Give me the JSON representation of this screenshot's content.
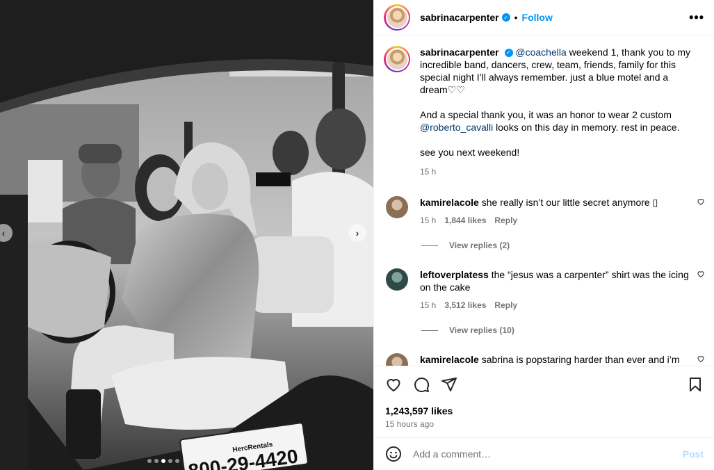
{
  "post": {
    "username": "sabrinacarpenter",
    "follow_label": "Follow",
    "separator": "•",
    "more_label": "•••",
    "plate_text": "800-29-4420",
    "plate_brand": "HercRentals",
    "caption": {
      "username": "sabrinacarpenter",
      "mention1": "@coachella",
      "text1": " weekend 1, thank you to my incredible band, dancers, crew, team, friends, family for this special night I’ll always remember. just a blue motel and a dream",
      "hearts": "♡♡",
      "text2a": "And a special thank you, it was an honor to wear 2 custom ",
      "mention2": "@roberto_cavalli",
      "text2b": " looks on this day in memory. rest in peace.",
      "text3": "see you next weekend!",
      "time": "15 h"
    },
    "comments": [
      {
        "username": "kamirelacole",
        "text": "she really isn’t our little secret anymore ▯",
        "time": "15 h",
        "likes": "1,844 likes",
        "reply": "Reply",
        "view_replies": "View replies (2)"
      },
      {
        "username": "leftoverplatess",
        "text": "the “jesus was a carpenter” shirt was the icing on the cake",
        "time": "15 h",
        "likes": "3,512 likes",
        "reply": "Reply",
        "view_replies": "View replies (10)"
      },
      {
        "username": "kamirelacole",
        "text": "sabrina is popstaring harder than ever and i’m here for it"
      }
    ],
    "likes_count": "1,243,597 likes",
    "posted_ago": "15 hours ago",
    "comment_placeholder": "Add a comment…",
    "post_label": "Post",
    "nav_prev": "‹",
    "nav_next": "›",
    "colors": {
      "accent": "#0095f6",
      "link": "#00376b",
      "muted": "#737373",
      "post_disabled": "#b3dbff"
    }
  }
}
